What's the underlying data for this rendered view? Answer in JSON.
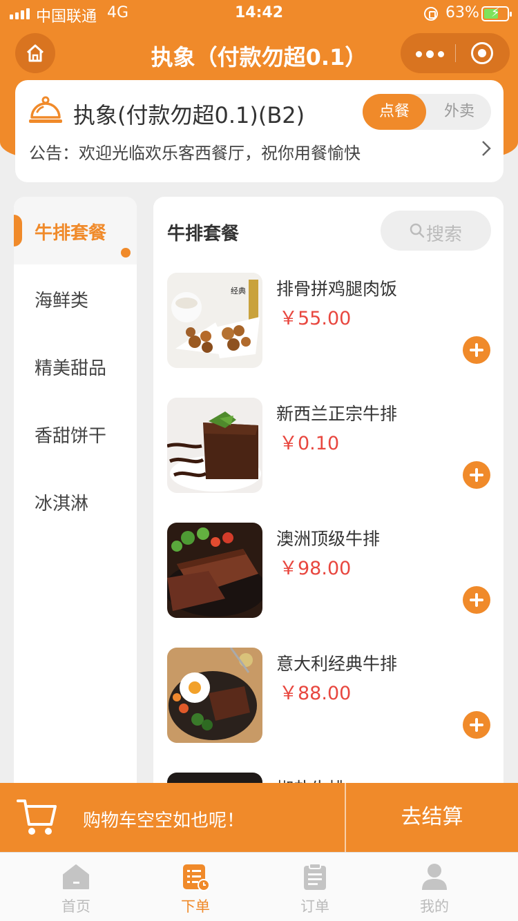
{
  "status_bar": {
    "carrier": "中国联通",
    "network": "4G",
    "time": "14:42",
    "battery": "63%",
    "battery_level": 0.63
  },
  "nav": {
    "title": "执象（付款勿超0.1）",
    "home_icon": "home-icon",
    "more_icon": "more-dots-icon",
    "close_icon": "target-icon"
  },
  "store": {
    "name": "执象(付款勿超0.1)(B2)",
    "icon": "food-dome-icon",
    "modes": [
      "点餐",
      "外卖"
    ],
    "active_mode": "点餐",
    "notice": "公告：欢迎光临欢乐客西餐厅，祝你用餐愉快"
  },
  "categories": {
    "items": [
      "牛排套餐",
      "海鲜类",
      "精美甜品",
      "香甜饼干",
      "冰淇淋"
    ],
    "active": "牛排套餐"
  },
  "section": {
    "title": "牛排套餐",
    "search_label": "搜索"
  },
  "products": [
    {
      "name": "排骨拼鸡腿肉饭",
      "price": "￥55.00"
    },
    {
      "name": "新西兰正宗牛排",
      "price": "￥0.10"
    },
    {
      "name": "澳洲顶级牛排",
      "price": "￥98.00"
    },
    {
      "name": "意大利经典牛排",
      "price": "￥88.00"
    }
  ],
  "partial_product": {
    "name": "椒盐牛排"
  },
  "cart": {
    "empty_text": "购物车空空如也呢！",
    "checkout_label": "去结算"
  },
  "tabs": [
    {
      "label": "首页",
      "icon": "home-icon",
      "active": false
    },
    {
      "label": "下单",
      "icon": "order-menu-icon",
      "active": true
    },
    {
      "label": "订单",
      "icon": "clipboard-icon",
      "active": false
    },
    {
      "label": "我的",
      "icon": "user-icon",
      "active": false
    }
  ],
  "colors": {
    "brand": "#f08a2a",
    "price": "#e8473f",
    "inactive": "#bbbbbb"
  }
}
